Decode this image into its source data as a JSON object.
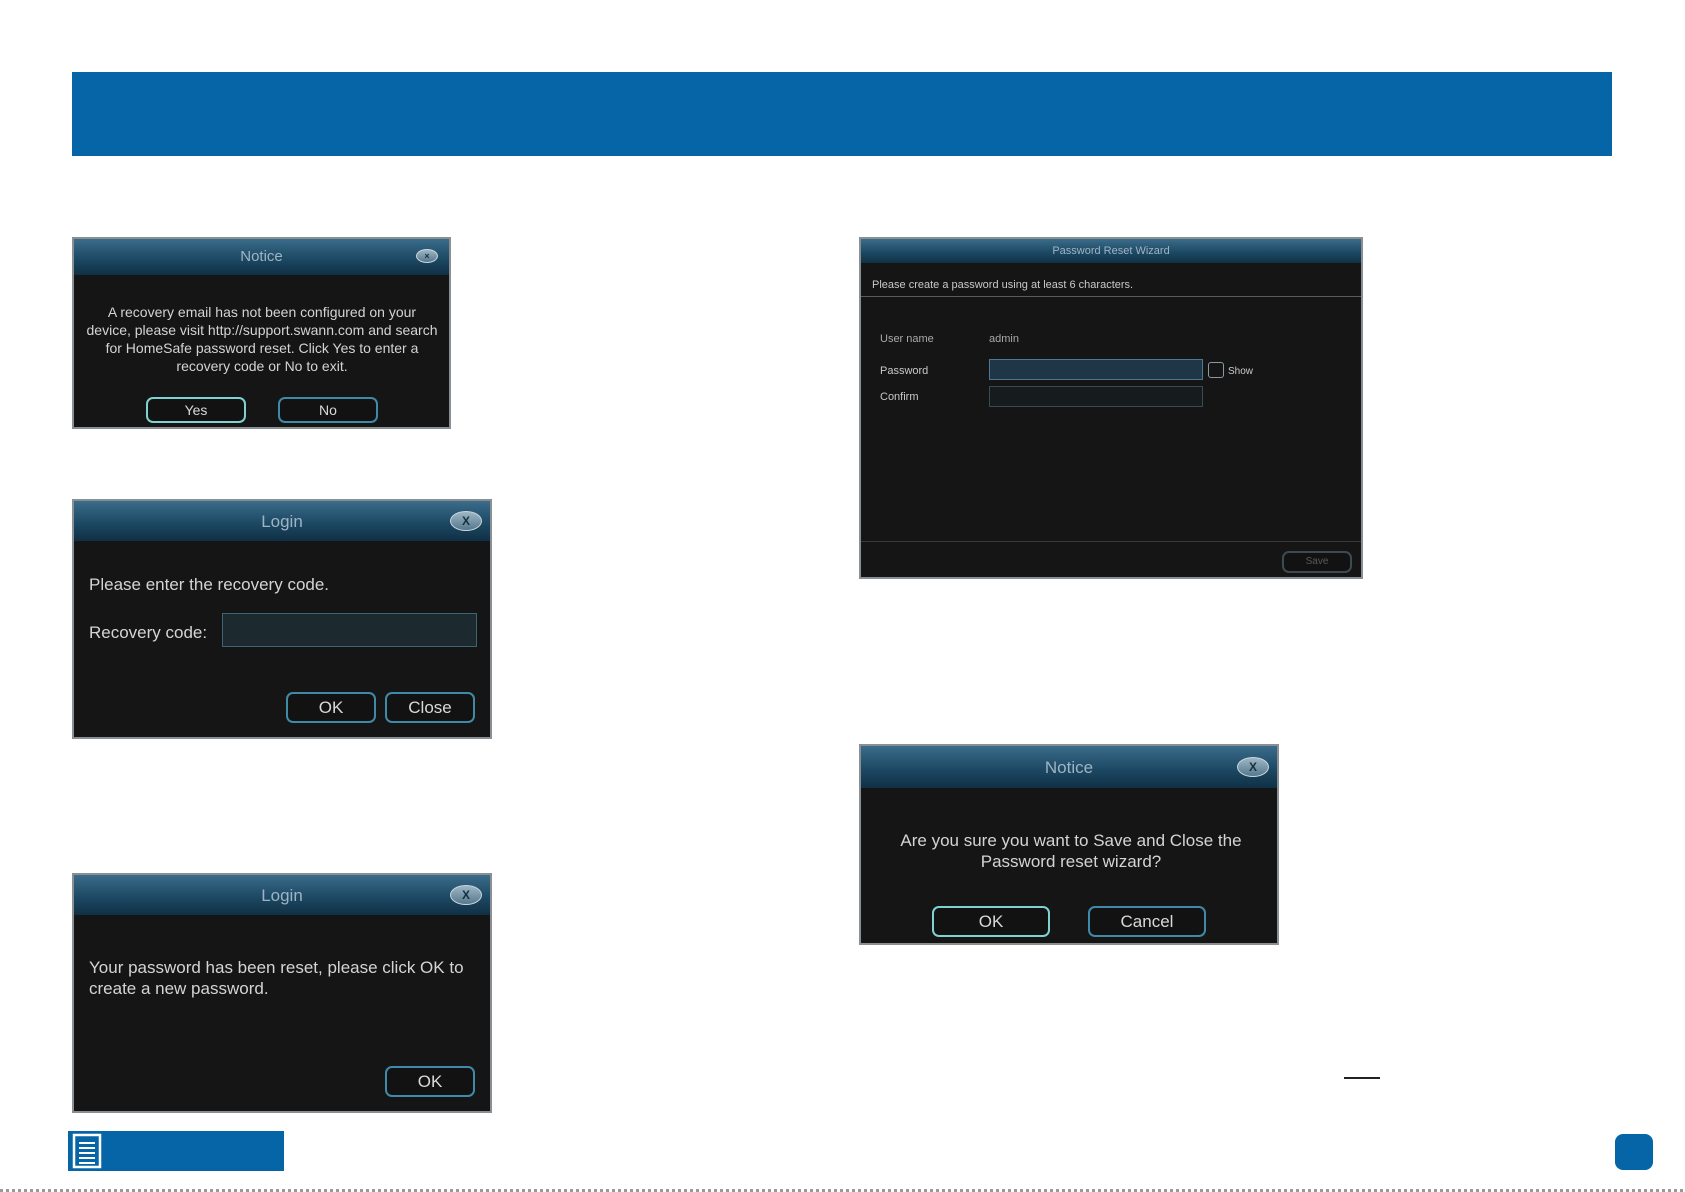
{
  "dialogs": {
    "notice1": {
      "title": "Notice",
      "message": "A recovery email has not been configured on your device, please visit http://support.swann.com and search for HomeSafe password reset. Click Yes to enter a recovery code or No to exit.",
      "yes_label": "Yes",
      "no_label": "No"
    },
    "login_recovery": {
      "title": "Login",
      "close_icon": "X",
      "message": "Please enter the recovery code.",
      "field_label": "Recovery code:",
      "field_value": "",
      "ok_label": "OK",
      "close_label": "Close"
    },
    "login_reset": {
      "title": "Login",
      "close_icon": "X",
      "message": "Your password has been reset, please click OK to create a new password.",
      "ok_label": "OK"
    },
    "wizard": {
      "title": "Password Reset Wizard",
      "instruction": "Please create a password using at least 6 characters.",
      "username_label": "User name",
      "username_value": "admin",
      "password_label": "Password",
      "password_value": "",
      "show_label": "Show",
      "confirm_label": "Confirm",
      "confirm_value": "",
      "save_label": "Save"
    },
    "notice2": {
      "title": "Notice",
      "close_icon": "X",
      "message": "Are you sure you want to Save and Close the Password reset wizard?",
      "ok_label": "OK",
      "cancel_label": "Cancel"
    }
  },
  "colors": {
    "brand_blue": "#0565a6",
    "dialog_bg": "#151515",
    "button_border": "#3f8aa8"
  },
  "icons": {
    "corner": "document-list-icon"
  }
}
